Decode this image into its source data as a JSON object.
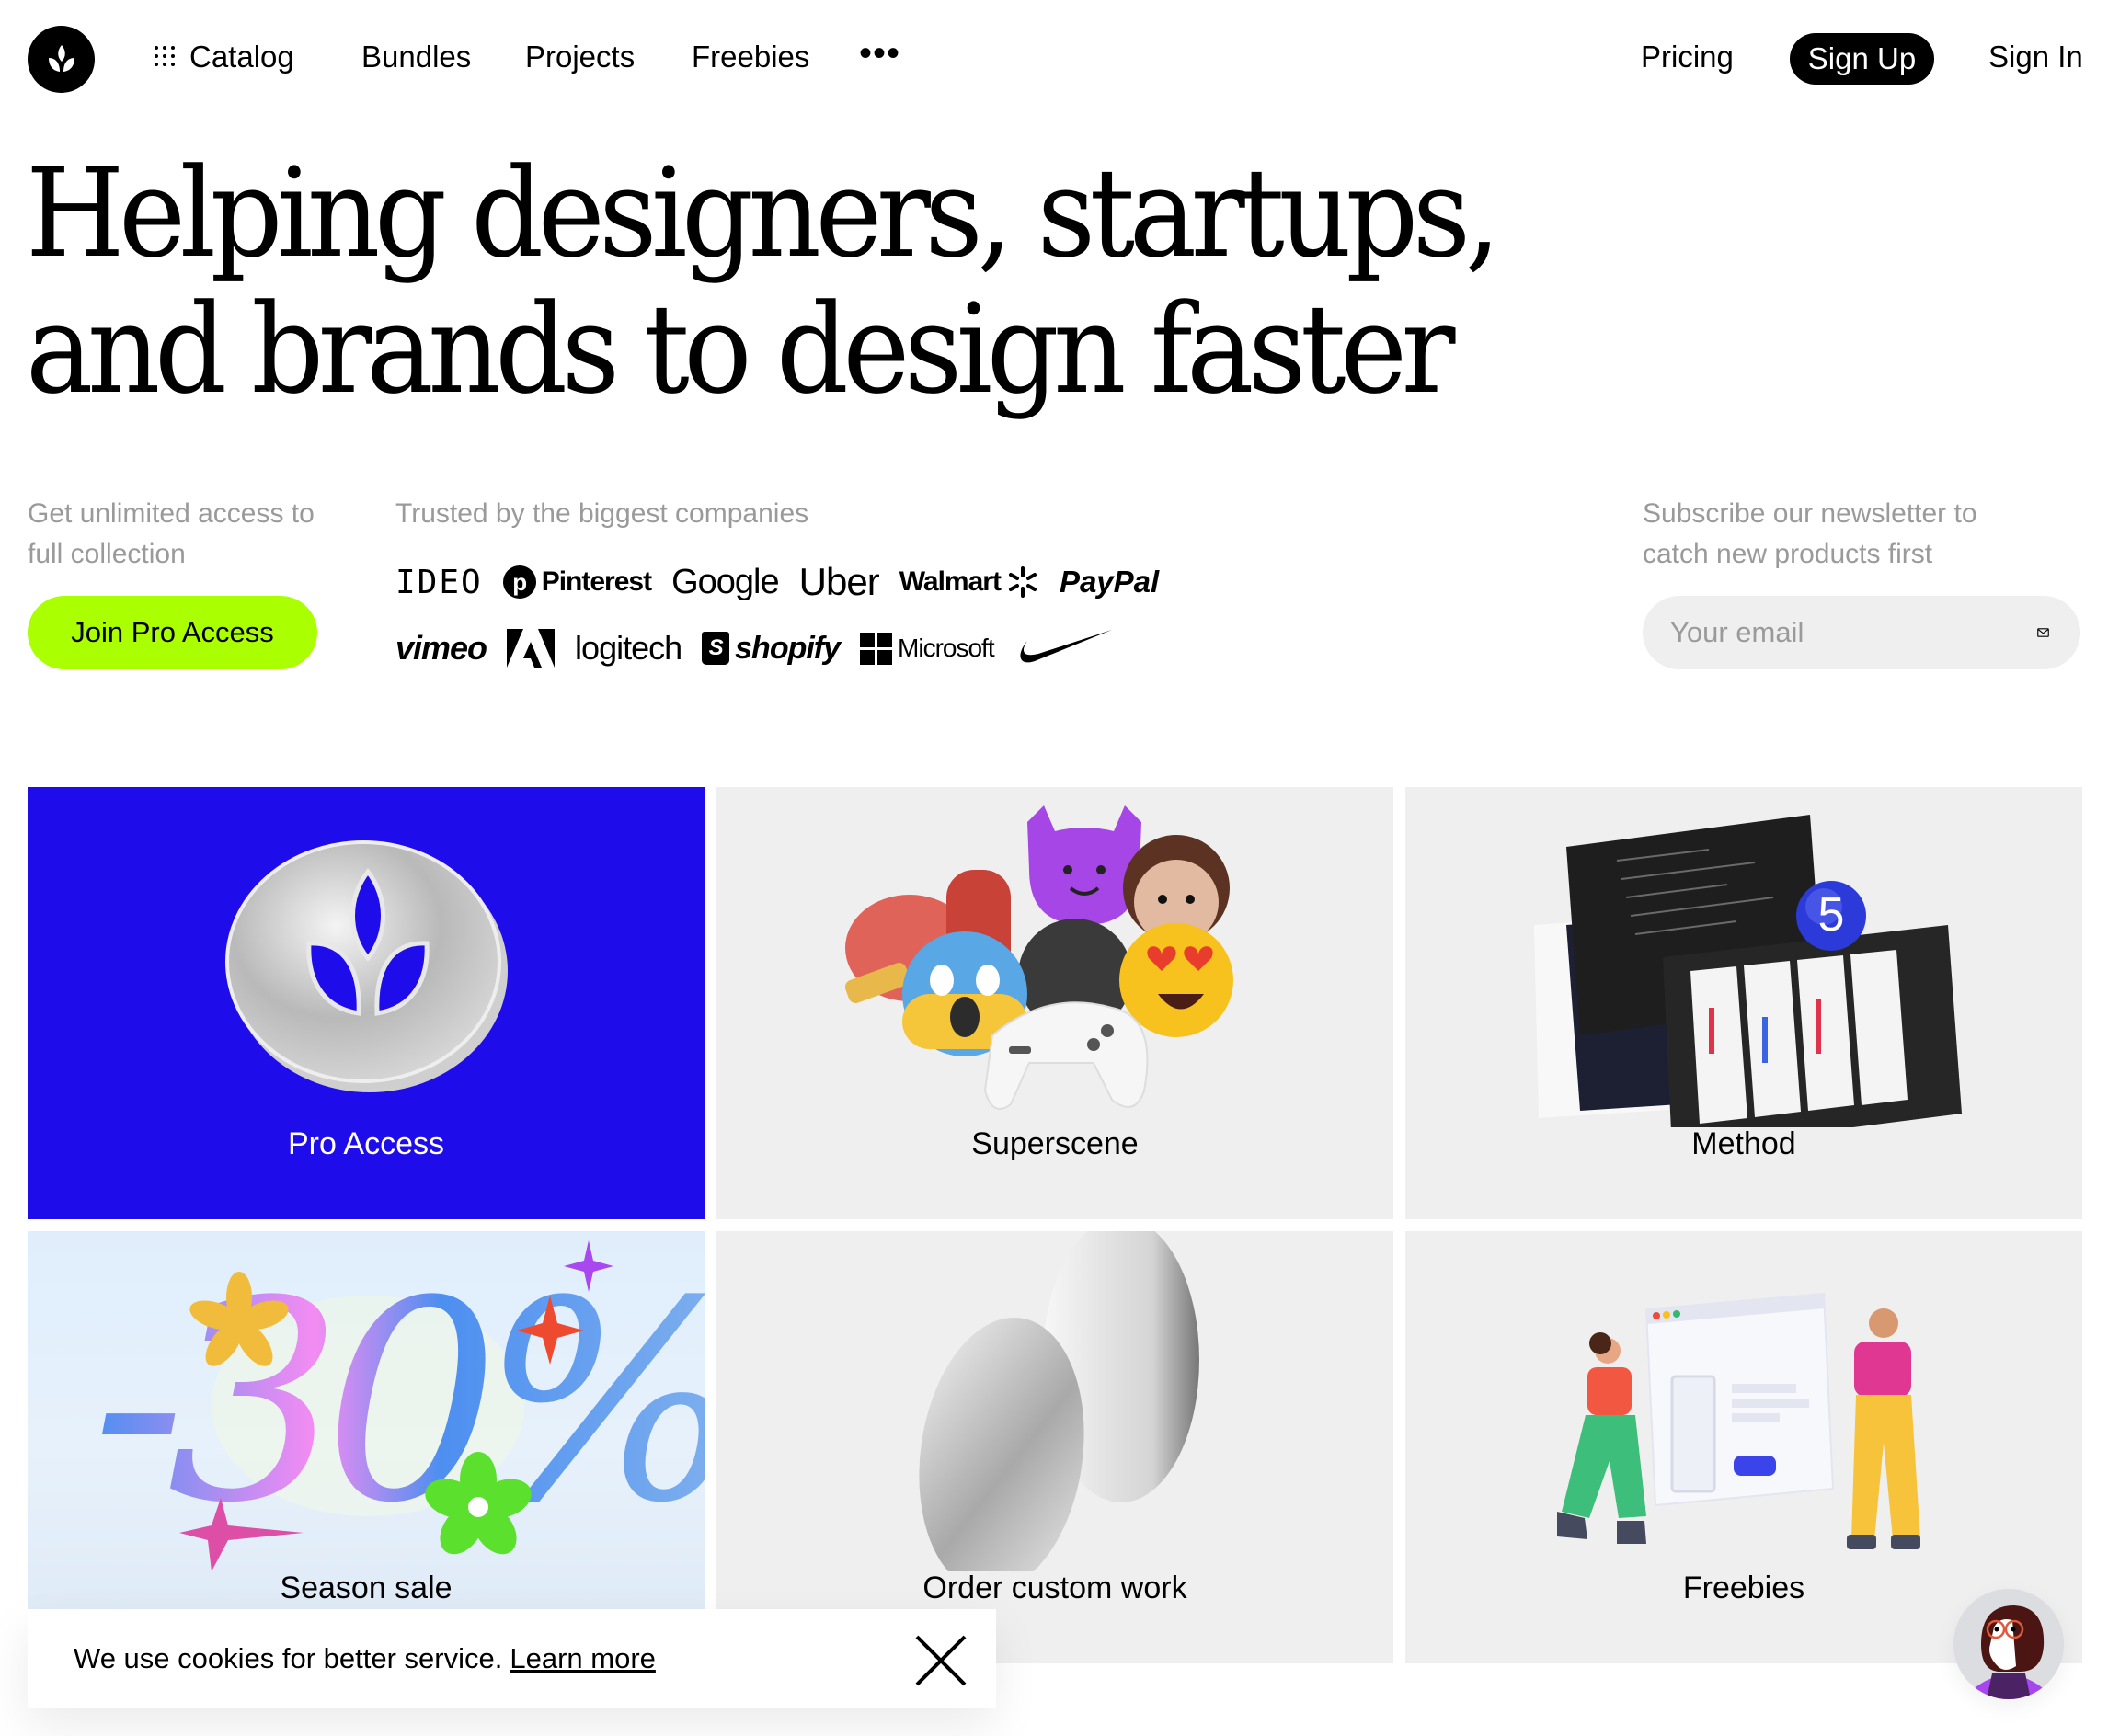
{
  "nav": {
    "logo_icon": "leaf-sprout-icon",
    "items": [
      {
        "label": "Catalog",
        "icon": "grid-dots-icon"
      },
      {
        "label": "Bundles"
      },
      {
        "label": "Projects"
      },
      {
        "label": "Freebies"
      }
    ],
    "more_label": "•••",
    "pricing_label": "Pricing",
    "signup_label": "Sign Up",
    "signin_label": "Sign In"
  },
  "hero": {
    "line1": "Helping designers, startups,",
    "line2": "and brands to design faster"
  },
  "pro": {
    "description": "Get unlimited access to full collection",
    "button_label": "Join Pro Access",
    "button_color": "#aaff00"
  },
  "trusted": {
    "label": "Trusted by the biggest companies",
    "row1": [
      "IDEO",
      "Pinterest",
      "Google",
      "Uber",
      "Walmart",
      "PayPal"
    ],
    "row2": [
      "vimeo",
      "Adobe",
      "logitech",
      "shopify",
      "Microsoft",
      "Nike"
    ],
    "pinterest_glyph": "p",
    "shopify_glyph": "S"
  },
  "newsletter": {
    "description": "Subscribe our newsletter to catch new products first",
    "email_placeholder": "Your email",
    "email_value": "",
    "submit_icon": "mail-icon"
  },
  "cards": [
    {
      "title": "Pro Access",
      "bg": "#1f0ceb",
      "art": "silver-leaf-coin"
    },
    {
      "title": "Superscene",
      "bg": "#efefef",
      "art": "3d-emoji-cluster"
    },
    {
      "title": "Method",
      "bg": "#efefef",
      "art": "ui-screens-badge-5",
      "badge": "5"
    },
    {
      "title": "Season sale",
      "bg": "#e0eefc",
      "art": "minus-30-percent",
      "art_text": "-30%"
    },
    {
      "title": "Order custom work",
      "bg": "#efefef",
      "art": "white-discs"
    },
    {
      "title": "Freebies",
      "bg": "#efefef",
      "art": "people-holding-browser"
    }
  ],
  "cookie": {
    "text": "We use cookies for better service.",
    "link_label": "Learn more",
    "close_icon": "close-icon"
  },
  "chat": {
    "avatar_icon": "support-avatar-icon"
  }
}
